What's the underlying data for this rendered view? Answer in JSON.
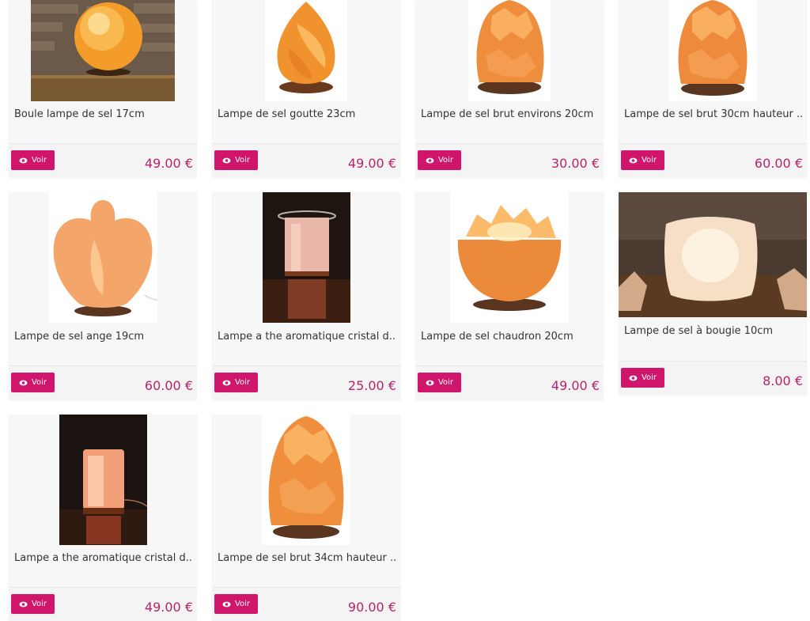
{
  "colors": {
    "accent": "#d0156c",
    "price": "#b8236a"
  },
  "products": [
    {
      "title": "Boule lampe de sel 17cm",
      "price": "49.00 €",
      "button": "Voir",
      "image": "salt-ball-lamp"
    },
    {
      "title": "Lampe de sel goutte 23cm",
      "price": "49.00 €",
      "button": "Voir",
      "image": "salt-drop-lamp"
    },
    {
      "title": "Lampe de sel brut environs 20cm",
      "price": "30.00 €",
      "button": "Voir",
      "image": "raw-salt-lamp"
    },
    {
      "title": "Lampe de sel brut 30cm hauteur ...",
      "price": "60.00 €",
      "button": "Voir",
      "image": "raw-salt-lamp-tall"
    },
    {
      "title": "Lampe de sel ange 19cm",
      "price": "60.00 €",
      "button": "Voir",
      "image": "angel-salt-lamp"
    },
    {
      "title": "Lampe a the aromatique cristal d...",
      "price": "25.00 €",
      "button": "Voir",
      "image": "aroma-crystal-lamp"
    },
    {
      "title": "Lampe de sel chaudron 20cm",
      "price": "49.00 €",
      "button": "Voir",
      "image": "cauldron-salt-lamp"
    },
    {
      "title": "Lampe de sel à bougie 10cm",
      "price": "8.00 €",
      "button": "Voir",
      "image": "candle-salt-holder"
    },
    {
      "title": "Lampe a the aromatique cristal d...",
      "price": "49.00 €",
      "button": "Voir",
      "image": "aroma-crystal-lamp-2"
    },
    {
      "title": "Lampe de sel brut 34cm hauteur ...",
      "price": "90.00 €",
      "button": "Voir",
      "image": "raw-salt-lamp-34"
    }
  ]
}
